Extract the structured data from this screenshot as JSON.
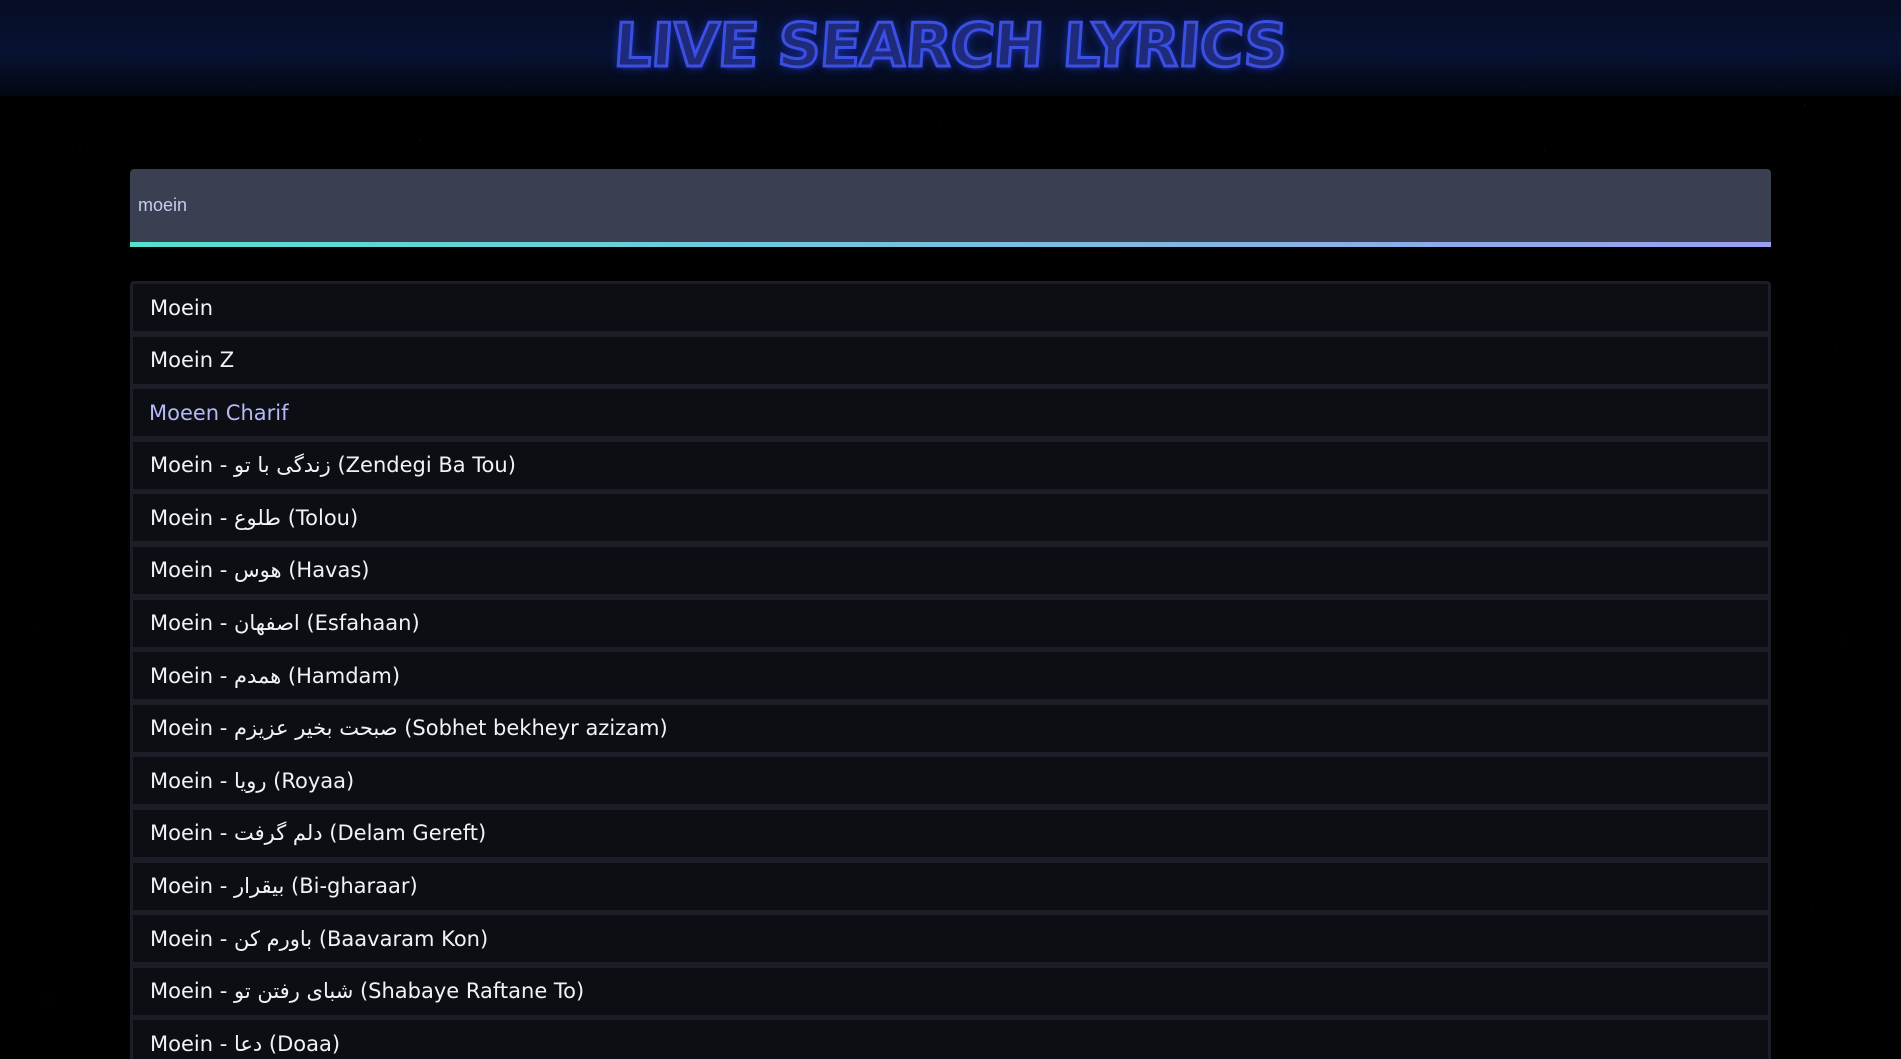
{
  "header": {
    "title": "LIVE SEARCH LYRICS"
  },
  "search": {
    "value": "moein"
  },
  "results": [
    "Moein",
    "Moein Z",
    "Moeen Charif",
    "Moein - زندگی با تو (Zendegi Ba Tou)",
    "Moein - طلوع (Tolou)",
    "Moein - هوس (Havas)",
    "Moein - اصفهان (Esfahaan)",
    "Moein - همدم (Hamdam)",
    "Moein - صبحت بخیر عزیزم (Sobhet bekheyr azizam)",
    "Moein - رویا (Royaa)",
    "Moein - دلم گرفت (Delam Gereft)",
    "Moein - بیقرار (Bi-gharaar)",
    "Moein - باورم کن (Baavaram Kon)",
    "Moein - شبای رفتن تو (Shabaye Raftane To)",
    "Moein - دعا (Doaa)"
  ],
  "hovered_index": 2
}
